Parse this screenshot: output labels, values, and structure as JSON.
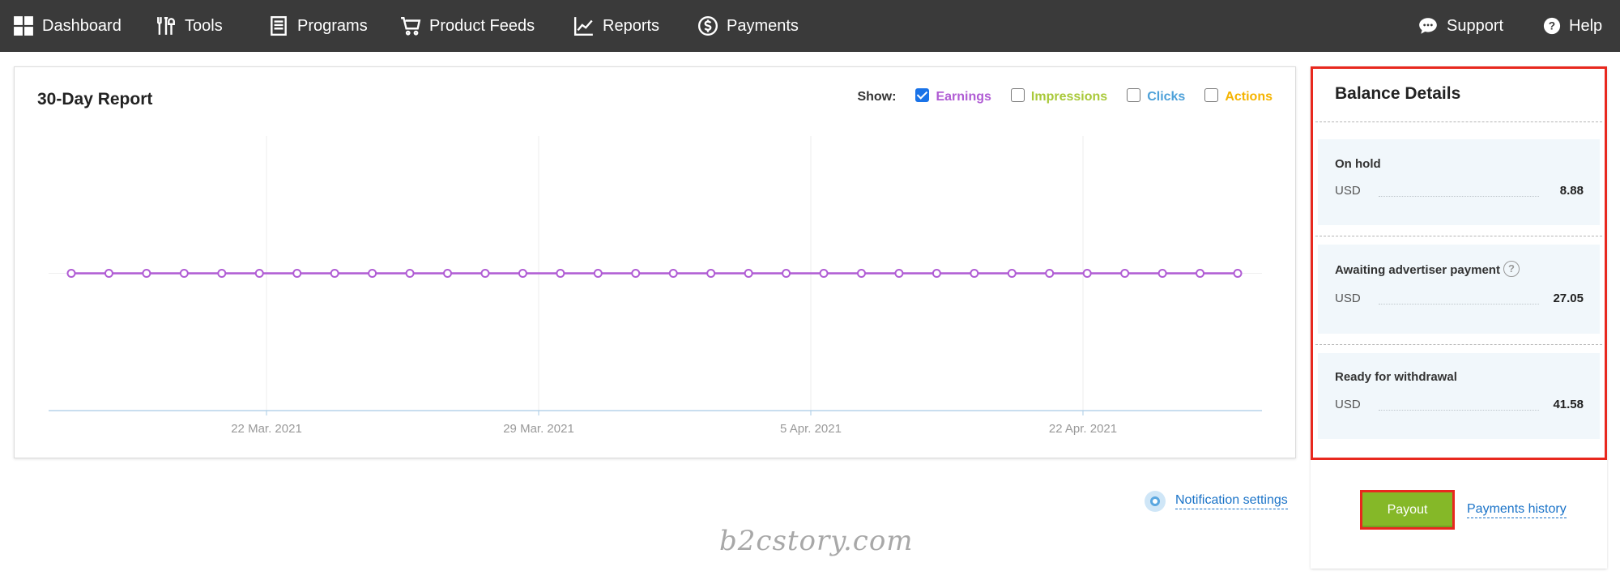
{
  "nav": {
    "left": [
      {
        "label": "Dashboard",
        "icon": "dashboard-grid-icon"
      },
      {
        "label": "Tools",
        "icon": "tools-icon"
      },
      {
        "label": "Programs",
        "icon": "programs-list-icon"
      },
      {
        "label": "Product Feeds",
        "icon": "cart-icon"
      },
      {
        "label": "Reports",
        "icon": "line-chart-icon"
      },
      {
        "label": "Payments",
        "icon": "dollar-circle-icon"
      }
    ],
    "right": [
      {
        "label": "Support",
        "icon": "chat-bubble-icon"
      },
      {
        "label": "Help",
        "icon": "question-circle-icon"
      }
    ]
  },
  "report": {
    "title": "30-Day Report",
    "show_label": "Show:",
    "toggles": [
      {
        "label": "Earnings",
        "checked": true,
        "color": "#b05cd4"
      },
      {
        "label": "Impressions",
        "checked": false,
        "color": "#a9c93a"
      },
      {
        "label": "Clicks",
        "checked": false,
        "color": "#4ea1d9"
      },
      {
        "label": "Actions",
        "checked": false,
        "color": "#f5b400"
      }
    ]
  },
  "chart_data": {
    "type": "line",
    "title": "30-Day Report",
    "x_tick_labels": [
      "22 Mar. 2021",
      "29 Mar. 2021",
      "5 Apr. 2021",
      "22 Apr. 2021"
    ],
    "series": [
      {
        "name": "Earnings",
        "color": "#b05cd4",
        "values": [
          0,
          0,
          0,
          0,
          0,
          0,
          0,
          0,
          0,
          0,
          0,
          0,
          0,
          0,
          0,
          0,
          0,
          0,
          0,
          0,
          0,
          0,
          0,
          0,
          0,
          0,
          0,
          0,
          0,
          0,
          0,
          0
        ]
      }
    ],
    "ylim": [
      -1,
      1
    ],
    "grid": true,
    "legend": "top-right"
  },
  "notification_settings": "Notification settings",
  "watermark": "b2cstory.com",
  "balance": {
    "title": "Balance Details",
    "blocks": [
      {
        "label": "On hold",
        "currency": "USD",
        "value": "8.88",
        "has_help": false
      },
      {
        "label": "Awaiting advertiser payment",
        "currency": "USD",
        "value": "27.05",
        "has_help": true
      },
      {
        "label": "Ready for withdrawal",
        "currency": "USD",
        "value": "41.58",
        "has_help": false
      }
    ],
    "help_glyph": "?",
    "payout_label": "Payout",
    "history_label": "Payments history"
  },
  "colors": {
    "nav_bg": "#3a3a3a",
    "accent_green": "#85b828",
    "highlight_red": "#e8281e",
    "link_blue": "#1a73c8"
  }
}
